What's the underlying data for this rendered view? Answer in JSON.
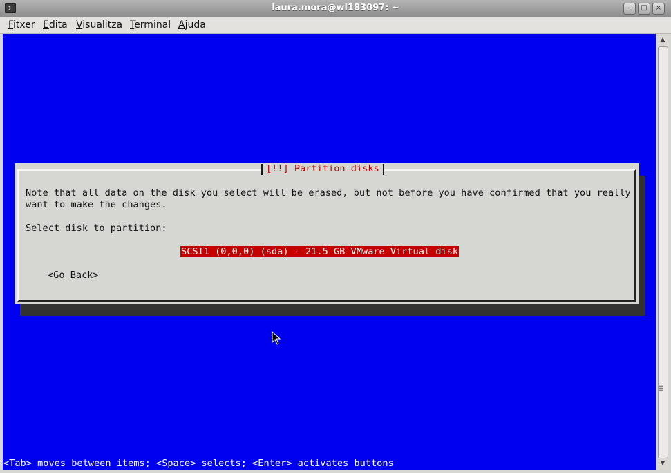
{
  "window": {
    "title": "laura.mora@wl183097: ~",
    "buttons": {
      "minimize": "–",
      "maximize": "□",
      "close": "×"
    }
  },
  "menu": [
    {
      "pre": "",
      "u": "F",
      "post": "itxer"
    },
    {
      "pre": "",
      "u": "E",
      "post": "dita"
    },
    {
      "pre": "",
      "u": "V",
      "post": "isualitza"
    },
    {
      "pre": "",
      "u": "T",
      "post": "erminal"
    },
    {
      "pre": "",
      "u": "A",
      "post": "juda"
    }
  ],
  "dialog": {
    "title": "[!!] Partition disks",
    "note_line1": "Note that all data on the disk you select will be erased, but not before you have confirmed that you really",
    "note_line2": "want to make the changes.",
    "prompt": "Select disk to partition:",
    "disk_option": "SCSI1 (0,0,0) (sda) - 21.5 GB VMware Virtual disk",
    "go_back": "<Go Back>"
  },
  "status_line": "<Tab> moves between items; <Space> selects; <Enter> activates buttons",
  "colors": {
    "terminal_bg": "#0000f0",
    "dialog_bg": "#d6d6d2",
    "accent_red": "#c40000"
  }
}
